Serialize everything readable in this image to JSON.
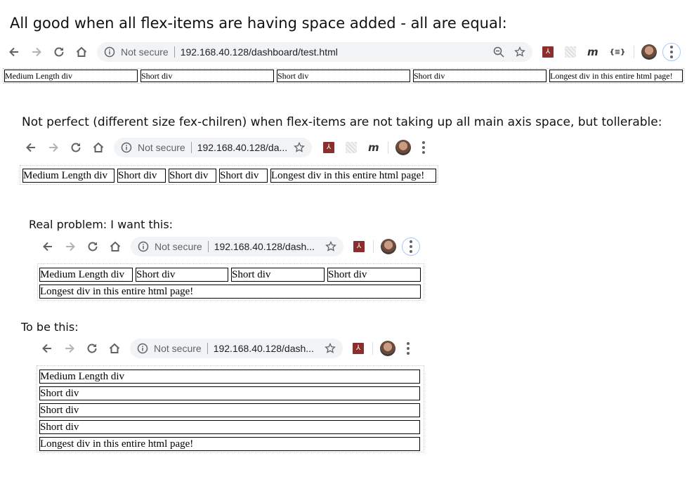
{
  "headings": {
    "h1": "All good when all flex-items are having space added - all are equal:",
    "h2": "Not perfect (different size fex-chilren) when flex-items are not taking up all main axis space, but tollerable:",
    "h3": "Real problem: I want this:",
    "h4": "To be this:"
  },
  "browser": {
    "not_secure": "Not secure",
    "url_full": "192.168.40.128/dashboard/test.html",
    "url_short2": "192.168.40.128/da...",
    "url_short3": "192.168.40.128/dash...",
    "url_short4": "192.168.40.128/dash...",
    "ext_pdf": "⅄",
    "ext_m": "m",
    "ext_json": "{≡}"
  },
  "icons": {
    "back": "arrow-left-icon",
    "forward": "arrow-right-icon",
    "reload": "reload-icon",
    "home": "home-icon",
    "info": "info-icon",
    "zoom": "zoom-out-icon",
    "star": "star-icon",
    "menu": "three-dot-menu-icon"
  },
  "colors": {
    "browser_gray": "#5f6368",
    "omnibox_bg": "#f1f3f4",
    "pdf_red": "#8b2e2e",
    "focus_ring": "#a8c7fa"
  },
  "demo1": {
    "items": [
      "Medium Length div",
      "Short div",
      "Short div",
      "Short div",
      "Longest div in this entire html page!"
    ]
  },
  "demo2": {
    "items": [
      "Medium Length div",
      "Short div",
      "Short div",
      "Short div",
      "Longest div in this entire html page!"
    ]
  },
  "demo3": {
    "row1": [
      "Medium Length div",
      "Short div",
      "Short div",
      "Short div"
    ],
    "row2": "Longest div in this entire html page!"
  },
  "demo4": {
    "items": [
      "Medium Length div",
      "Short div",
      "Short div",
      "Short div",
      "Longest div in this entire html page!"
    ]
  }
}
